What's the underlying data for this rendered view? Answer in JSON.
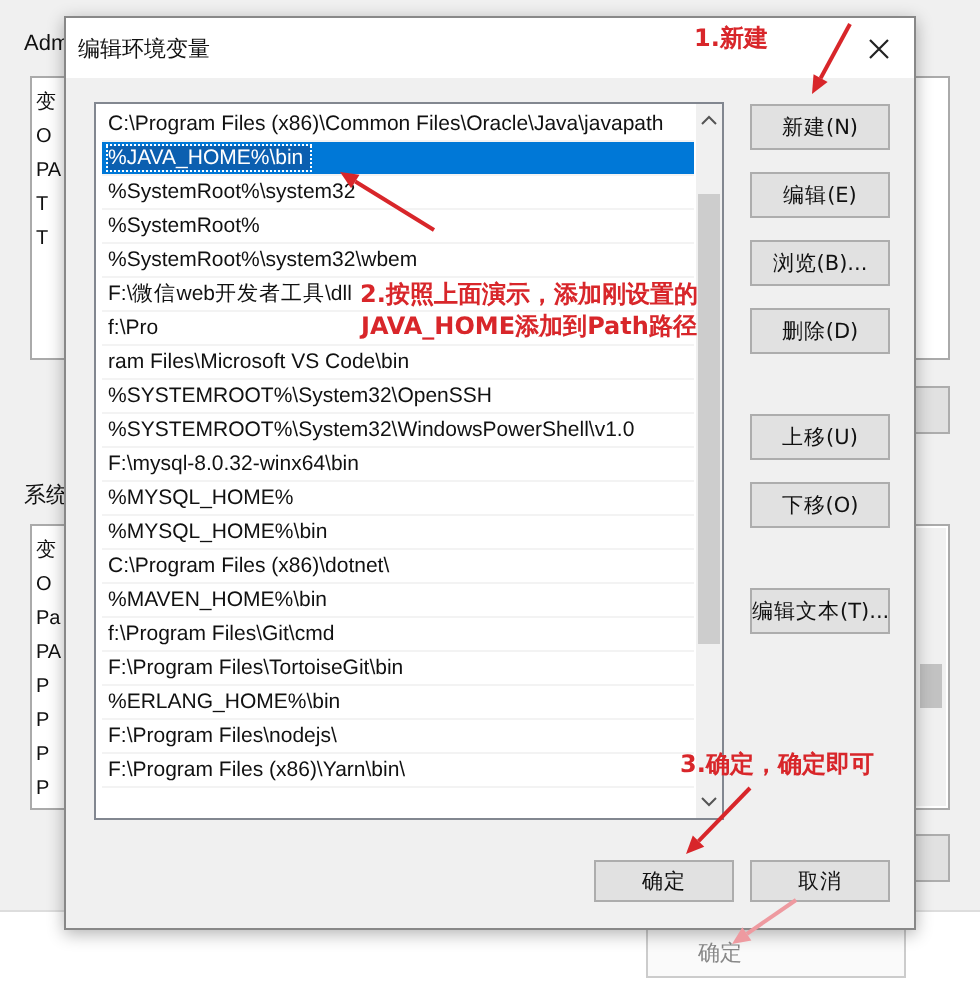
{
  "background_window": {
    "top_label": "Adm",
    "top_list": [
      "变",
      "O",
      "PA",
      "T",
      "T"
    ],
    "bottom_label": "系统",
    "bottom_list": [
      "变",
      "O",
      "Pa",
      "PA",
      "P",
      "P",
      "P",
      "P"
    ],
    "ok_button": "确定"
  },
  "dialog": {
    "title": "编辑环境变量",
    "paths": [
      {
        "text": "C:\\Program Files (x86)\\Common Files\\Oracle\\Java\\javapath",
        "selected": false
      },
      {
        "text": "%JAVA_HOME%\\bin",
        "selected": true
      },
      {
        "text": "%SystemRoot%\\system32",
        "selected": false
      },
      {
        "text": "%SystemRoot%",
        "selected": false
      },
      {
        "text": "%SystemRoot%\\system32\\wbem",
        "selected": false
      },
      {
        "text": "F:\\微信web开发者工具\\dll",
        "selected": false
      },
      {
        "text": "f:\\Pro",
        "selected": false
      },
      {
        "text": "ram Files\\Microsoft VS Code\\bin",
        "selected": false
      },
      {
        "text": "%SYSTEMROOT%\\System32\\OpenSSH",
        "selected": false
      },
      {
        "text": "%SYSTEMROOT%\\System32\\WindowsPowerShell\\v1.0",
        "selected": false
      },
      {
        "text": "F:\\mysql-8.0.32-winx64\\bin",
        "selected": false
      },
      {
        "text": "%MYSQL_HOME%",
        "selected": false
      },
      {
        "text": "%MYSQL_HOME%\\bin",
        "selected": false
      },
      {
        "text": "C:\\Program Files (x86)\\dotnet\\",
        "selected": false
      },
      {
        "text": "%MAVEN_HOME%\\bin",
        "selected": false
      },
      {
        "text": "f:\\Program Files\\Git\\cmd",
        "selected": false
      },
      {
        "text": "F:\\Program Files\\TortoiseGit\\bin",
        "selected": false
      },
      {
        "text": "%ERLANG_HOME%\\bin",
        "selected": false
      },
      {
        "text": "F:\\Program Files\\nodejs\\",
        "selected": false
      },
      {
        "text": "F:\\Program Files (x86)\\Yarn\\bin\\",
        "selected": false
      }
    ],
    "side_button_groups": [
      [
        "新建(N)",
        "编辑(E)",
        "浏览(B)...",
        "删除(D)"
      ],
      [
        "上移(U)",
        "下移(O)"
      ],
      [
        "编辑文本(T)..."
      ]
    ],
    "ok_button": "确定",
    "cancel_button": "取消"
  },
  "annotations": [
    {
      "lines": [
        "1.新建"
      ]
    },
    {
      "lines": [
        "2.按照上面演示，添加刚设置的",
        "JAVA_HOME添加到Path路径"
      ]
    },
    {
      "lines": [
        "3.确定，确定即可"
      ]
    }
  ]
}
